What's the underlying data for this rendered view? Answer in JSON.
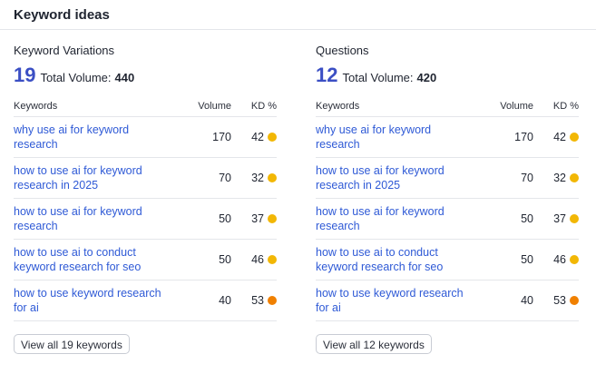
{
  "header": {
    "title": "Keyword ideas"
  },
  "colors": {
    "accent": "#3b4fc4",
    "link": "#2f5ad6",
    "kd_yellow": "#f2b705",
    "kd_orange": "#f08000"
  },
  "panels": [
    {
      "title": "Keyword Variations",
      "count": "19",
      "total_label": "Total Volume:",
      "total_value": "440",
      "columns": {
        "keywords": "Keywords",
        "volume": "Volume",
        "kd": "KD %"
      },
      "rows": [
        {
          "keyword": "why use ai for keyword research",
          "volume": "170",
          "kd": "42",
          "kd_color": "#f2b705"
        },
        {
          "keyword": "how to use ai for keyword research in 2025",
          "volume": "70",
          "kd": "32",
          "kd_color": "#f2b705"
        },
        {
          "keyword": "how to use ai for keyword research",
          "volume": "50",
          "kd": "37",
          "kd_color": "#f2b705"
        },
        {
          "keyword": "how to use ai to conduct keyword research for seo",
          "volume": "50",
          "kd": "46",
          "kd_color": "#f2b705"
        },
        {
          "keyword": "how to use keyword research for ai",
          "volume": "40",
          "kd": "53",
          "kd_color": "#f08000"
        }
      ],
      "view_all_label": "View all 19 keywords"
    },
    {
      "title": "Questions",
      "count": "12",
      "total_label": "Total Volume:",
      "total_value": "420",
      "columns": {
        "keywords": "Keywords",
        "volume": "Volume",
        "kd": "KD %"
      },
      "rows": [
        {
          "keyword": "why use ai for keyword research",
          "volume": "170",
          "kd": "42",
          "kd_color": "#f2b705"
        },
        {
          "keyword": "how to use ai for keyword research in 2025",
          "volume": "70",
          "kd": "32",
          "kd_color": "#f2b705"
        },
        {
          "keyword": "how to use ai for keyword research",
          "volume": "50",
          "kd": "37",
          "kd_color": "#f2b705"
        },
        {
          "keyword": "how to use ai to conduct keyword research for seo",
          "volume": "50",
          "kd": "46",
          "kd_color": "#f2b705"
        },
        {
          "keyword": "how to use keyword research for ai",
          "volume": "40",
          "kd": "53",
          "kd_color": "#f08000"
        }
      ],
      "view_all_label": "View all 12 keywords"
    }
  ]
}
